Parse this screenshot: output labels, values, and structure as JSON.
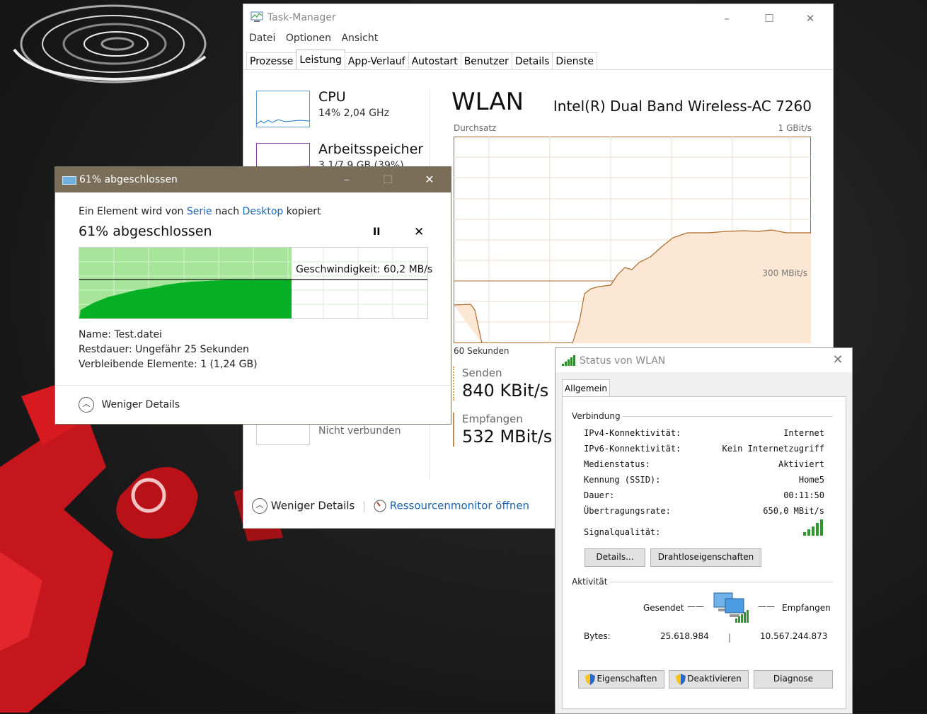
{
  "task_manager": {
    "title": "Task-Manager",
    "window_controls": [
      "–",
      "☐",
      "✕"
    ],
    "menu": [
      "Datei",
      "Optionen",
      "Ansicht"
    ],
    "tabs": [
      "Prozesse",
      "Leistung",
      "App-Verlauf",
      "Autostart",
      "Benutzer",
      "Details",
      "Dienste"
    ],
    "active_tab": "Leistung",
    "sidebar": [
      {
        "name": "CPU",
        "sub": "14% 2,04 GHz"
      },
      {
        "name": "Arbeitsspeicher",
        "sub": "3,1/7,9 GB (39%)"
      },
      {
        "name": "",
        "sub": "Nicht verbunden"
      }
    ],
    "panel": {
      "title": "WLAN",
      "adapter": "Intel(R) Dual Band Wireless-AC 7260",
      "throughput_label": "Durchsatz",
      "max_label": "1 GBit/s",
      "mid_label": "300 MBit/s",
      "time_label": "60 Sekunden",
      "send_label": "Senden",
      "send_value": "840 KBit/s",
      "receive_label": "Empfangen",
      "receive_value": "532 MBit/s"
    },
    "footer": {
      "less_details": "Weniger Details",
      "resource_monitor": "Ressourcenmonitor öffnen"
    }
  },
  "copy_dialog": {
    "title": "61% abgeschlossen",
    "line_prefix": "Ein Element wird von ",
    "source": "Serie",
    "line_mid": " nach ",
    "destination": "Desktop",
    "line_suffix": " kopiert",
    "heading": "61% abgeschlossen",
    "pause_icon": "II",
    "cancel_icon": "✕",
    "progress": 0.61,
    "speed": "Geschwindigkeit: 60,2 MB/s",
    "name": "Name: Test.datei",
    "remaining_time": "Restdauer: Ungefähr 25 Sekunden",
    "remaining_items": "Verbleibende Elemente: 1 (1,24 GB)",
    "less_details": "Weniger Details",
    "colors": {
      "fill": "#06b025",
      "light_fill": "#a6e59a",
      "title_bar": "#7a6e58"
    }
  },
  "wlan_status": {
    "title": "Status von WLAN",
    "tab": "Allgemein",
    "connection_group": "Verbindung",
    "rows": [
      {
        "key": "IPv4-Konnektivität:",
        "value": "Internet"
      },
      {
        "key": "IPv6-Konnektivität:",
        "value": "Kein Internetzugriff"
      },
      {
        "key": "Medienstatus:",
        "value": "Aktiviert"
      },
      {
        "key": "Kennung (SSID):",
        "value": "Home5"
      },
      {
        "key": "Dauer:",
        "value": "00:11:50"
      },
      {
        "key": "Übertragungsrate:",
        "value": "650,0 MBit/s"
      }
    ],
    "signal_label": "Signalqualität:",
    "signal_bars": 5,
    "details_button": "Details...",
    "wireless_props_button": "Drahtloseigenschaften",
    "activity_group": "Aktivität",
    "sent_label": "Gesendet",
    "received_label": "Empfangen",
    "bytes_label": "Bytes:",
    "bytes_sent": "25.618.984",
    "bytes_received": "10.567.244.873",
    "properties_button": "Eigenschaften",
    "disable_button": "Deaktivieren",
    "diagnose_button": "Diagnose"
  }
}
